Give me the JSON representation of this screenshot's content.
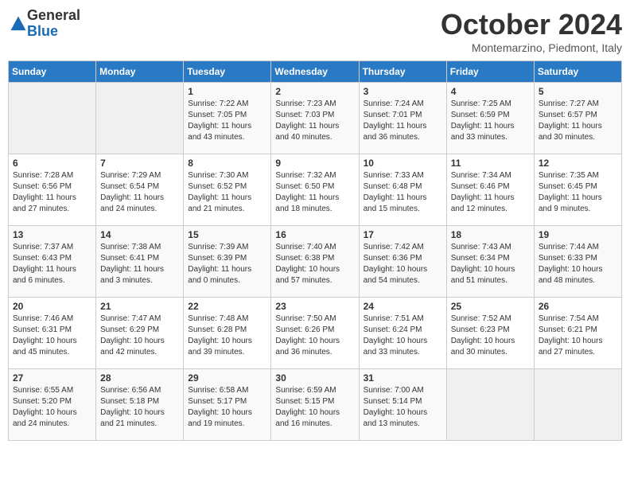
{
  "logo": {
    "general": "General",
    "blue": "Blue"
  },
  "title": "October 2024",
  "subtitle": "Montemarzino, Piedmont, Italy",
  "days_of_week": [
    "Sunday",
    "Monday",
    "Tuesday",
    "Wednesday",
    "Thursday",
    "Friday",
    "Saturday"
  ],
  "weeks": [
    [
      {
        "day": "",
        "info": ""
      },
      {
        "day": "",
        "info": ""
      },
      {
        "day": "1",
        "info": "Sunrise: 7:22 AM\nSunset: 7:05 PM\nDaylight: 11 hours and 43 minutes."
      },
      {
        "day": "2",
        "info": "Sunrise: 7:23 AM\nSunset: 7:03 PM\nDaylight: 11 hours and 40 minutes."
      },
      {
        "day": "3",
        "info": "Sunrise: 7:24 AM\nSunset: 7:01 PM\nDaylight: 11 hours and 36 minutes."
      },
      {
        "day": "4",
        "info": "Sunrise: 7:25 AM\nSunset: 6:59 PM\nDaylight: 11 hours and 33 minutes."
      },
      {
        "day": "5",
        "info": "Sunrise: 7:27 AM\nSunset: 6:57 PM\nDaylight: 11 hours and 30 minutes."
      }
    ],
    [
      {
        "day": "6",
        "info": "Sunrise: 7:28 AM\nSunset: 6:56 PM\nDaylight: 11 hours and 27 minutes."
      },
      {
        "day": "7",
        "info": "Sunrise: 7:29 AM\nSunset: 6:54 PM\nDaylight: 11 hours and 24 minutes."
      },
      {
        "day": "8",
        "info": "Sunrise: 7:30 AM\nSunset: 6:52 PM\nDaylight: 11 hours and 21 minutes."
      },
      {
        "day": "9",
        "info": "Sunrise: 7:32 AM\nSunset: 6:50 PM\nDaylight: 11 hours and 18 minutes."
      },
      {
        "day": "10",
        "info": "Sunrise: 7:33 AM\nSunset: 6:48 PM\nDaylight: 11 hours and 15 minutes."
      },
      {
        "day": "11",
        "info": "Sunrise: 7:34 AM\nSunset: 6:46 PM\nDaylight: 11 hours and 12 minutes."
      },
      {
        "day": "12",
        "info": "Sunrise: 7:35 AM\nSunset: 6:45 PM\nDaylight: 11 hours and 9 minutes."
      }
    ],
    [
      {
        "day": "13",
        "info": "Sunrise: 7:37 AM\nSunset: 6:43 PM\nDaylight: 11 hours and 6 minutes."
      },
      {
        "day": "14",
        "info": "Sunrise: 7:38 AM\nSunset: 6:41 PM\nDaylight: 11 hours and 3 minutes."
      },
      {
        "day": "15",
        "info": "Sunrise: 7:39 AM\nSunset: 6:39 PM\nDaylight: 11 hours and 0 minutes."
      },
      {
        "day": "16",
        "info": "Sunrise: 7:40 AM\nSunset: 6:38 PM\nDaylight: 10 hours and 57 minutes."
      },
      {
        "day": "17",
        "info": "Sunrise: 7:42 AM\nSunset: 6:36 PM\nDaylight: 10 hours and 54 minutes."
      },
      {
        "day": "18",
        "info": "Sunrise: 7:43 AM\nSunset: 6:34 PM\nDaylight: 10 hours and 51 minutes."
      },
      {
        "day": "19",
        "info": "Sunrise: 7:44 AM\nSunset: 6:33 PM\nDaylight: 10 hours and 48 minutes."
      }
    ],
    [
      {
        "day": "20",
        "info": "Sunrise: 7:46 AM\nSunset: 6:31 PM\nDaylight: 10 hours and 45 minutes."
      },
      {
        "day": "21",
        "info": "Sunrise: 7:47 AM\nSunset: 6:29 PM\nDaylight: 10 hours and 42 minutes."
      },
      {
        "day": "22",
        "info": "Sunrise: 7:48 AM\nSunset: 6:28 PM\nDaylight: 10 hours and 39 minutes."
      },
      {
        "day": "23",
        "info": "Sunrise: 7:50 AM\nSunset: 6:26 PM\nDaylight: 10 hours and 36 minutes."
      },
      {
        "day": "24",
        "info": "Sunrise: 7:51 AM\nSunset: 6:24 PM\nDaylight: 10 hours and 33 minutes."
      },
      {
        "day": "25",
        "info": "Sunrise: 7:52 AM\nSunset: 6:23 PM\nDaylight: 10 hours and 30 minutes."
      },
      {
        "day": "26",
        "info": "Sunrise: 7:54 AM\nSunset: 6:21 PM\nDaylight: 10 hours and 27 minutes."
      }
    ],
    [
      {
        "day": "27",
        "info": "Sunrise: 6:55 AM\nSunset: 5:20 PM\nDaylight: 10 hours and 24 minutes."
      },
      {
        "day": "28",
        "info": "Sunrise: 6:56 AM\nSunset: 5:18 PM\nDaylight: 10 hours and 21 minutes."
      },
      {
        "day": "29",
        "info": "Sunrise: 6:58 AM\nSunset: 5:17 PM\nDaylight: 10 hours and 19 minutes."
      },
      {
        "day": "30",
        "info": "Sunrise: 6:59 AM\nSunset: 5:15 PM\nDaylight: 10 hours and 16 minutes."
      },
      {
        "day": "31",
        "info": "Sunrise: 7:00 AM\nSunset: 5:14 PM\nDaylight: 10 hours and 13 minutes."
      },
      {
        "day": "",
        "info": ""
      },
      {
        "day": "",
        "info": ""
      }
    ]
  ]
}
